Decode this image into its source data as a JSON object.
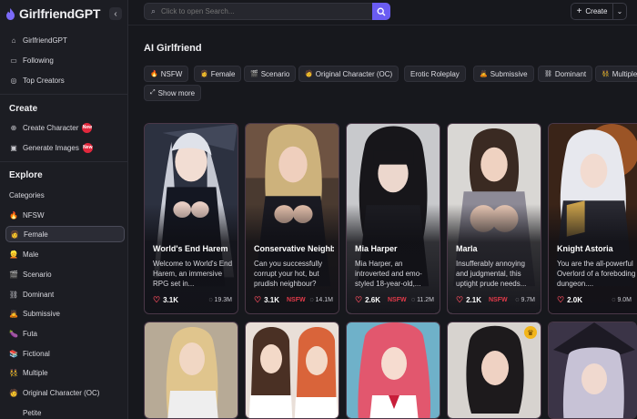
{
  "brand": {
    "name": "GirlfriendGPT",
    "collapse_icon": "chevron-left-icon"
  },
  "sidebar": {
    "top_items": [
      {
        "label": "GirlfriendGPT",
        "icon": "home-icon"
      },
      {
        "label": "Following",
        "icon": "following-icon"
      },
      {
        "label": "Top Creators",
        "icon": "trophy-icon"
      }
    ],
    "create_title": "Create",
    "create_items": [
      {
        "label": "Create Character",
        "icon": "user-plus-icon",
        "badge": "New"
      },
      {
        "label": "Generate Images",
        "icon": "image-icon",
        "badge": "New"
      }
    ],
    "explore_title": "Explore",
    "categories_label": "Categories",
    "categories": [
      {
        "label": "NFSW",
        "emoji": "🔥"
      },
      {
        "label": "Female",
        "emoji": "👩",
        "active": true
      },
      {
        "label": "Male",
        "emoji": "👱"
      },
      {
        "label": "Scenario",
        "emoji": "🎬"
      },
      {
        "label": "Dominant",
        "emoji": "⛓"
      },
      {
        "label": "Submissive",
        "emoji": "🙇"
      },
      {
        "label": "Futa",
        "emoji": "🍆"
      },
      {
        "label": "Fictional",
        "emoji": "📚"
      },
      {
        "label": "Multiple",
        "emoji": "👯"
      },
      {
        "label": "Original Character (OC)",
        "emoji": "🧑"
      },
      {
        "label": "Petite",
        "emoji": ""
      }
    ]
  },
  "topbar": {
    "search_placeholder": "Click to open Search...",
    "create_label": "Create"
  },
  "main": {
    "title": "AI Girlfriend",
    "chips": [
      {
        "label": "NSFW",
        "emoji": "🔥"
      },
      {
        "label": "Female",
        "emoji": "👩"
      },
      {
        "label": "Scenario",
        "emoji": "🎬"
      },
      {
        "label": "Original Character (OC)",
        "emoji": "🧑"
      },
      {
        "label": "Erotic Roleplay",
        "emoji": ""
      },
      {
        "label": "Submissive",
        "emoji": "🙇"
      },
      {
        "label": "Dominant",
        "emoji": "⛓"
      },
      {
        "label": "Multiple",
        "emoji": "👯"
      }
    ],
    "show_more_label": "Show more",
    "cards": [
      {
        "name": "World's End Harem",
        "desc": "Welcome to World's End Harem, an immersive RPG set in...",
        "likes": "3.1K",
        "nsfw": "",
        "chats": "19.3M"
      },
      {
        "name": "Conservative Neighbour",
        "desc": "Can you successfully corrupt your hot, but prudish neighbour?",
        "likes": "3.1K",
        "nsfw": "NSFW",
        "chats": "14.1M"
      },
      {
        "name": "Mia Harper",
        "desc": "Mia Harper, an introverted and emo-styled 18-year-old,...",
        "likes": "2.6K",
        "nsfw": "NSFW",
        "chats": "11.2M"
      },
      {
        "name": "Marla",
        "desc": "Insufferably annoying and judgmental, this uptight prude needs...",
        "likes": "2.1K",
        "nsfw": "NSFW",
        "chats": "9.7M"
      },
      {
        "name": "Knight Astoria",
        "desc": "You are the all-powerful Overlord of a foreboding dungeon....",
        "likes": "2.0K",
        "nsfw": "",
        "chats": "9.0M"
      }
    ]
  },
  "colors": {
    "accent": "#6a5cf2",
    "nsfw": "#e23a49",
    "badge": "#e2283d",
    "heart": "#ff4e5f"
  }
}
